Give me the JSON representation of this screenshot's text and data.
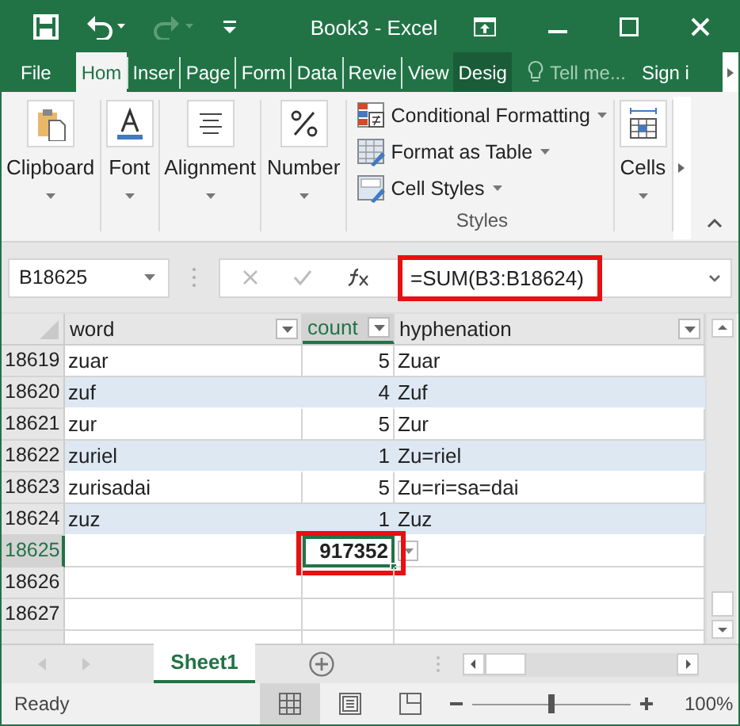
{
  "window": {
    "title": "Book3 - Excel"
  },
  "ribbon_tabs": [
    {
      "label": "File",
      "kind": "file",
      "selected": false
    },
    {
      "label": "Hom",
      "kind": "tab",
      "selected": true
    },
    {
      "label": "Inser",
      "kind": "tab",
      "selected": false
    },
    {
      "label": "Page",
      "kind": "tab",
      "selected": false
    },
    {
      "label": "Form",
      "kind": "tab",
      "selected": false
    },
    {
      "label": "Data",
      "kind": "tab",
      "selected": false
    },
    {
      "label": "Revie",
      "kind": "tab",
      "selected": false
    },
    {
      "label": "View",
      "kind": "tab",
      "selected": false
    },
    {
      "label": "Desig",
      "kind": "context",
      "selected": false
    }
  ],
  "tell_me": {
    "placeholder": "Tell me..."
  },
  "sign_in": "Sign i",
  "ribbon_groups": [
    {
      "label": "Clipboard",
      "kind": "clipboard"
    },
    {
      "label": "Font",
      "kind": "font"
    },
    {
      "label": "Alignment",
      "kind": "alignment"
    },
    {
      "label": "Number",
      "kind": "number"
    }
  ],
  "styles_group": {
    "label": "Styles",
    "items": [
      {
        "label": "Conditional Formatting",
        "kind": "conditional"
      },
      {
        "label": "Format as Table",
        "kind": "table"
      },
      {
        "label": "Cell Styles",
        "kind": "styles"
      }
    ]
  },
  "cells_group": {
    "label": "Cells"
  },
  "name_box": "B18625",
  "formula": {
    "value": "=SUM(B3:B18624)",
    "highlighted": true
  },
  "columns": [
    {
      "label": "word",
      "selected": false
    },
    {
      "label": "count",
      "selected": true
    },
    {
      "label": "hyphenation",
      "selected": false
    }
  ],
  "rows": [
    {
      "number": "18619",
      "selected": false,
      "banded": false,
      "cells": [
        "zuar",
        "5",
        "Zuar"
      ]
    },
    {
      "number": "18620",
      "selected": false,
      "banded": true,
      "cells": [
        "zuf",
        "4",
        "Zuf"
      ]
    },
    {
      "number": "18621",
      "selected": false,
      "banded": false,
      "cells": [
        "zur",
        "5",
        "Zur"
      ]
    },
    {
      "number": "18622",
      "selected": false,
      "banded": true,
      "cells": [
        "zuriel",
        "1",
        "Zu=riel"
      ]
    },
    {
      "number": "18623",
      "selected": false,
      "banded": false,
      "cells": [
        "zurisadai",
        "5",
        "Zu=ri=sa=dai"
      ]
    },
    {
      "number": "18624",
      "selected": false,
      "banded": true,
      "cells": [
        "zuz",
        "1",
        "Zuz"
      ]
    },
    {
      "number": "18625",
      "selected": true,
      "banded": false,
      "cells": [
        "",
        "917352",
        ""
      ],
      "active": true,
      "highlighted": true
    },
    {
      "number": "18626",
      "selected": false,
      "banded": false,
      "cells": [
        "",
        "",
        ""
      ]
    },
    {
      "number": "18627",
      "selected": false,
      "banded": false,
      "cells": [
        "",
        "",
        ""
      ]
    },
    {
      "selected": false,
      "banded": false,
      "cells": [
        "",
        "",
        ""
      ]
    }
  ],
  "sheet_tabs": [
    {
      "label": "Sheet1",
      "selected": true
    }
  ],
  "status_bar": {
    "status": "Ready",
    "views": [
      {
        "kind": "normal",
        "selected": true
      },
      {
        "kind": "layout",
        "selected": false
      },
      {
        "kind": "break",
        "selected": false
      }
    ],
    "zoom": {
      "level": 0.5,
      "reading": "100%"
    }
  }
}
